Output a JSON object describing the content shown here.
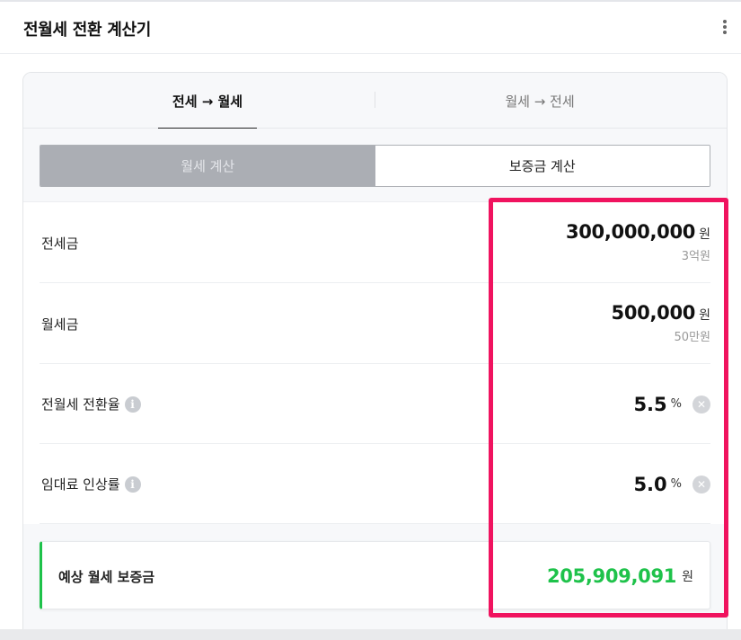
{
  "header": {
    "title": "전월세 전환 계산기",
    "menu_icon": "more-vertical-icon"
  },
  "tabs": [
    {
      "label": "전세 → 월세",
      "active": true
    },
    {
      "label": "월세 → 전세",
      "active": false
    }
  ],
  "mode_toggle": {
    "options": [
      {
        "label": "월세 계산",
        "selected": false
      },
      {
        "label": "보증금 계산",
        "selected": true
      }
    ]
  },
  "fields": {
    "jeonse": {
      "label": "전세금",
      "value": "300,000,000",
      "unit": "원",
      "sub": "3억원"
    },
    "monthly": {
      "label": "월세금",
      "value": "500,000",
      "unit": "원",
      "sub": "50만원"
    },
    "conversion_rate": {
      "label": "전월세 전환율",
      "value": "5.5",
      "unit": "%",
      "info_icon": "i"
    },
    "increase_rate": {
      "label": "임대료 인상률",
      "value": "5.0",
      "unit": "%",
      "info_icon": "i"
    }
  },
  "result": {
    "label": "예상 월세 보증금",
    "value": "205,909,091",
    "unit": "원"
  },
  "colors": {
    "accent_green": "#1ec24a",
    "highlight": "#f0135f"
  }
}
